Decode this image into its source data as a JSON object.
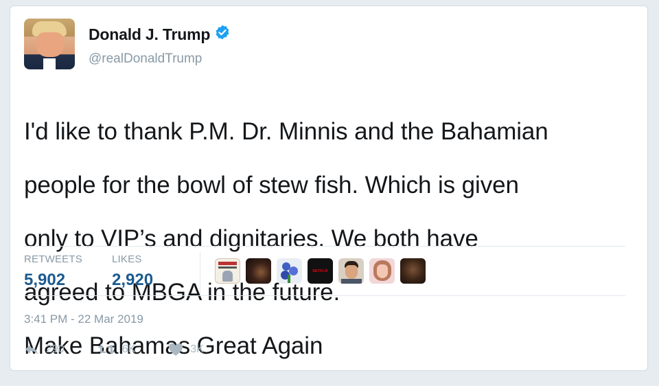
{
  "author": {
    "name": "Donald J. Trump",
    "handle": "@realDonaldTrump",
    "verified_color": "#1da1f2"
  },
  "tweet": {
    "text_lines": [
      "I'd like to thank P.M. Dr. Minnis and the Bahamian",
      "people for the bowl of stew fish. Which is given",
      "only to VIP’s and dignitaries. We both have",
      "agreed to MBGA in the future.",
      "Make Bahamas Great Again"
    ]
  },
  "stats": {
    "retweets_label": "RETWEETS",
    "retweets_count": "5,902",
    "likes_label": "LIKES",
    "likes_count": "2,920"
  },
  "liker_avatars": [
    {
      "icon": "book-cover-avatar"
    },
    {
      "icon": "dark-portrait-avatar"
    },
    {
      "icon": "blue-flower-avatar"
    },
    {
      "icon": "netflix-logo-avatar",
      "text": "NETFLIX"
    },
    {
      "icon": "man-portrait-avatar"
    },
    {
      "icon": "woman-portrait-avatar"
    },
    {
      "icon": "dark-brown-avatar"
    }
  ],
  "timestamp": "3:41 PM - 22 Mar 2019",
  "actions": {
    "reply_count": "290",
    "retweet_count": "6K",
    "like_count": "3K"
  },
  "colors": {
    "link_count": "#1b5a8f",
    "muted": "#8899a6",
    "action": "#aab8c2"
  }
}
